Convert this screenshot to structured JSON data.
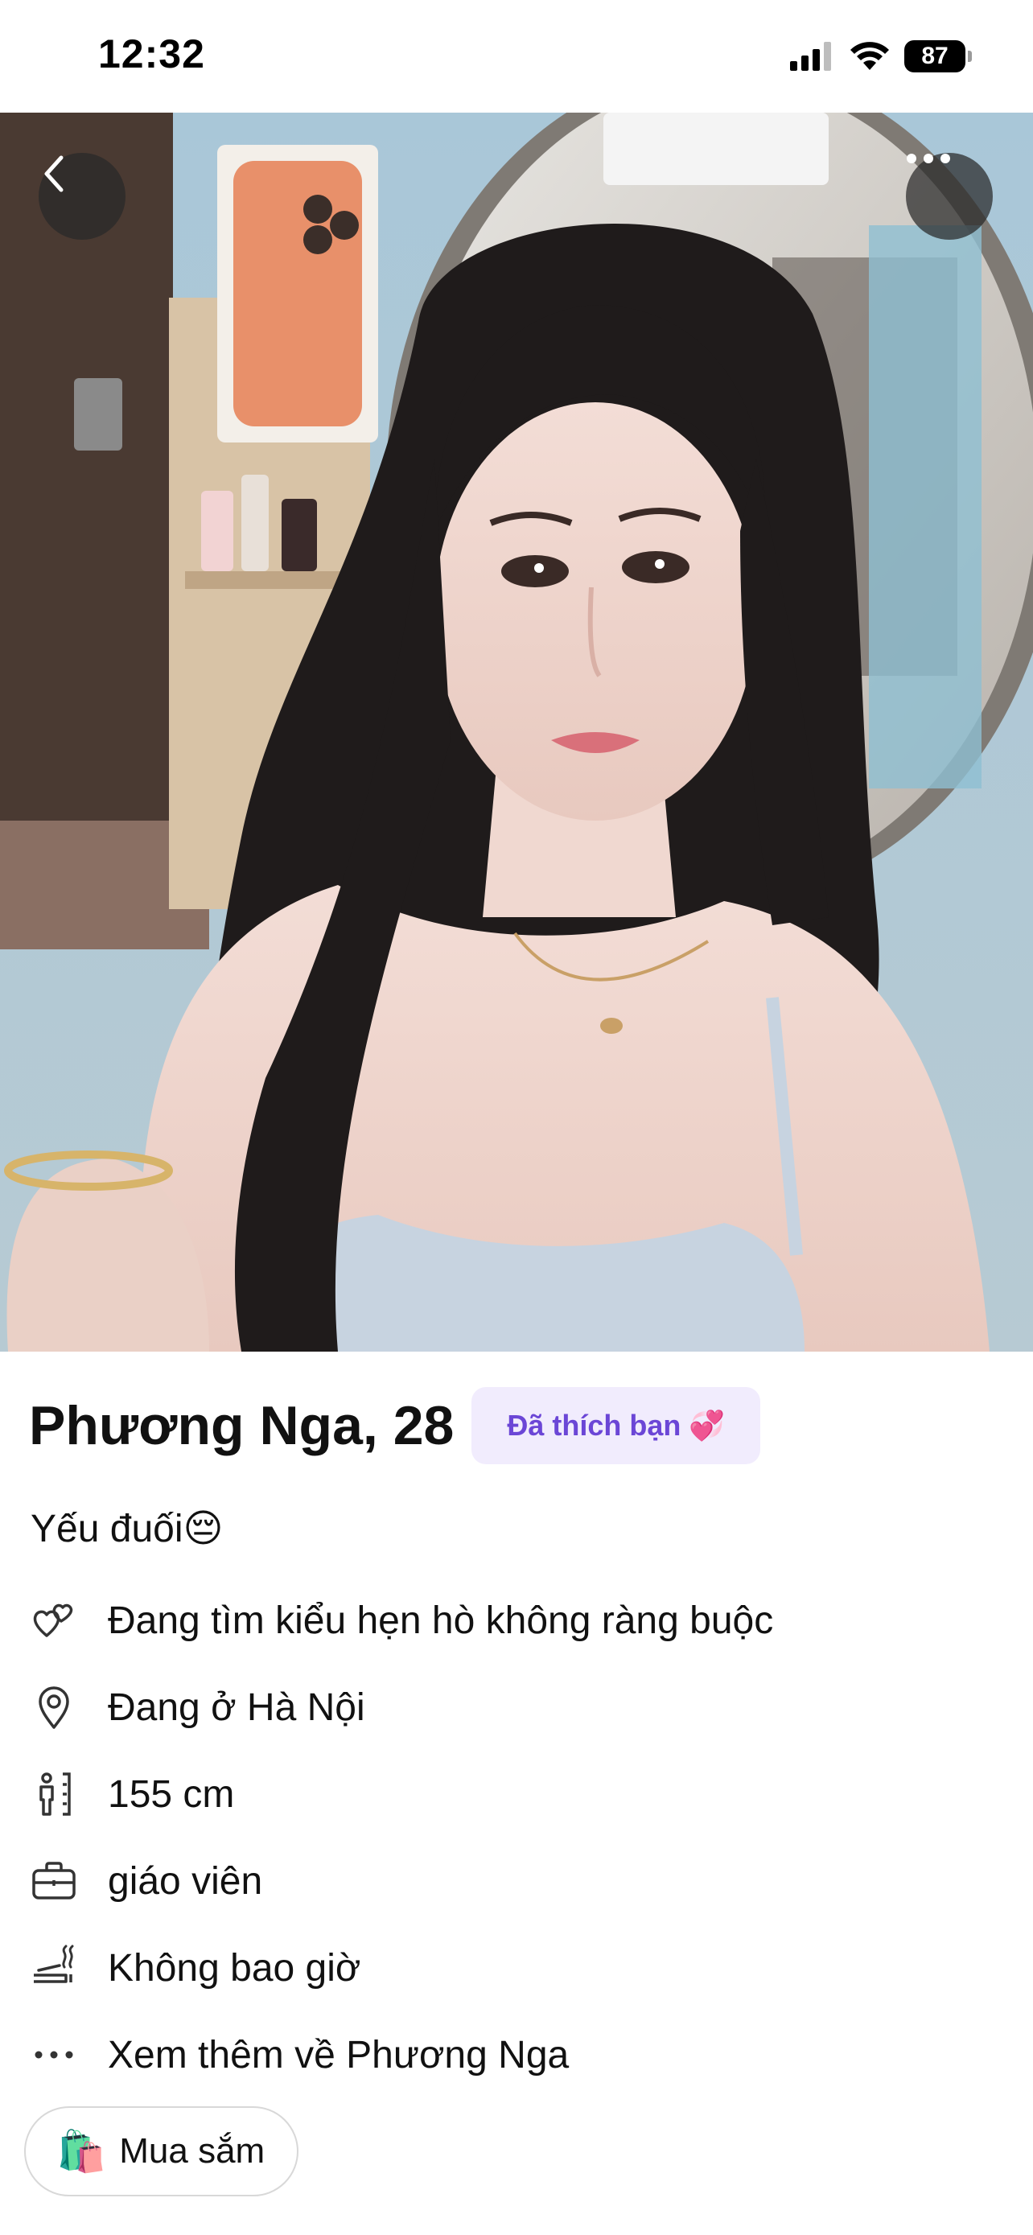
{
  "status_bar": {
    "time": "12:32",
    "battery_level": "87"
  },
  "profile": {
    "name_age": "Phương Nga, 28",
    "liked_badge": "Đã thích bạn 💞",
    "bio": "Yếu đuối😔",
    "details": [
      {
        "icon": "hearts-icon",
        "text": "Đang tìm kiểu hẹn hò không ràng buộc"
      },
      {
        "icon": "location-pin-icon",
        "text": "Đang ở Hà Nội"
      },
      {
        "icon": "height-icon",
        "text": "155 cm"
      },
      {
        "icon": "briefcase-icon",
        "text": "giáo viên"
      },
      {
        "icon": "smoking-icon",
        "text": "Không bao giờ"
      },
      {
        "icon": "more-dots-icon",
        "text": "Xem thêm về Phương Nga"
      }
    ]
  },
  "shop_button": {
    "emoji": "🛍️",
    "label": "Mua sắm"
  }
}
